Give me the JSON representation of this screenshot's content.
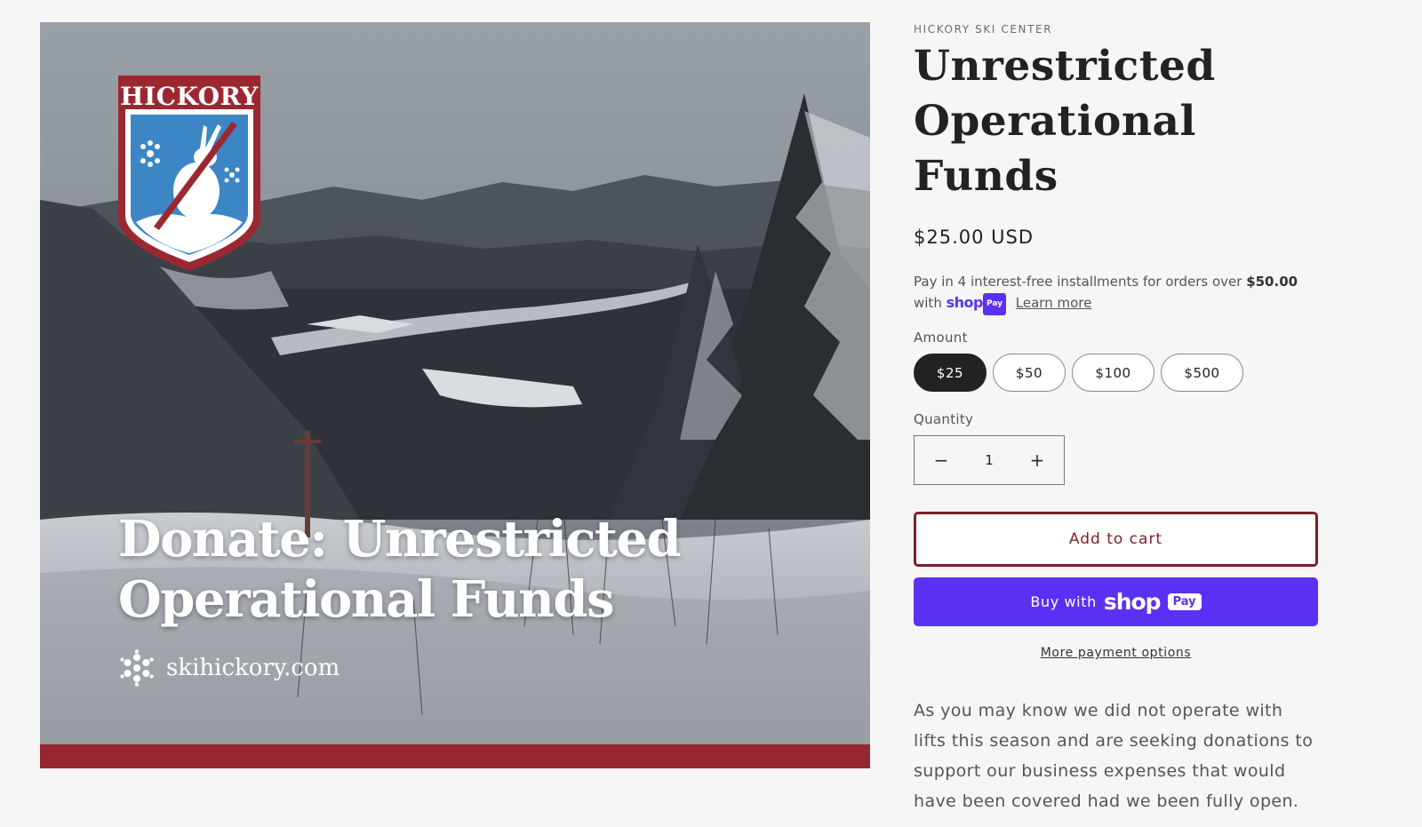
{
  "product_image": {
    "crest_text": "HICKORY",
    "headline_line1": "Donate: Unrestricted",
    "headline_line2": "Operational Funds",
    "website": "skihickory.com"
  },
  "product": {
    "vendor": "HICKORY SKI CENTER",
    "title_line1": "Unrestricted",
    "title_line2": "Operational",
    "title_line3": "Funds",
    "price": "$25.00 USD"
  },
  "installments": {
    "text_before": "Pay in 4 interest-free installments for orders over",
    "threshold": "$50.00",
    "with": "with",
    "shop_word": "shop",
    "pay_badge": "Pay",
    "learn_more": "Learn more"
  },
  "amount": {
    "label": "Amount",
    "options": [
      "$25",
      "$50",
      "$100",
      "$500"
    ],
    "selected": "$25"
  },
  "quantity": {
    "label": "Quantity",
    "value": "1",
    "minus": "−",
    "plus": "+"
  },
  "buttons": {
    "add_to_cart": "Add to cart",
    "buy_with": "Buy with",
    "shop_word": "shop",
    "pay_badge": "Pay",
    "more_payment_options": "More payment options"
  },
  "description": "As you may know we did not operate with lifts this season and are seeking donations to support our business expenses that would have been covered had we been fully open.",
  "colors": {
    "accent_maroon": "#7c1f29",
    "shop_pay_purple": "#5a31f4",
    "selected_pill": "#222222",
    "image_band_red": "#96262f"
  }
}
